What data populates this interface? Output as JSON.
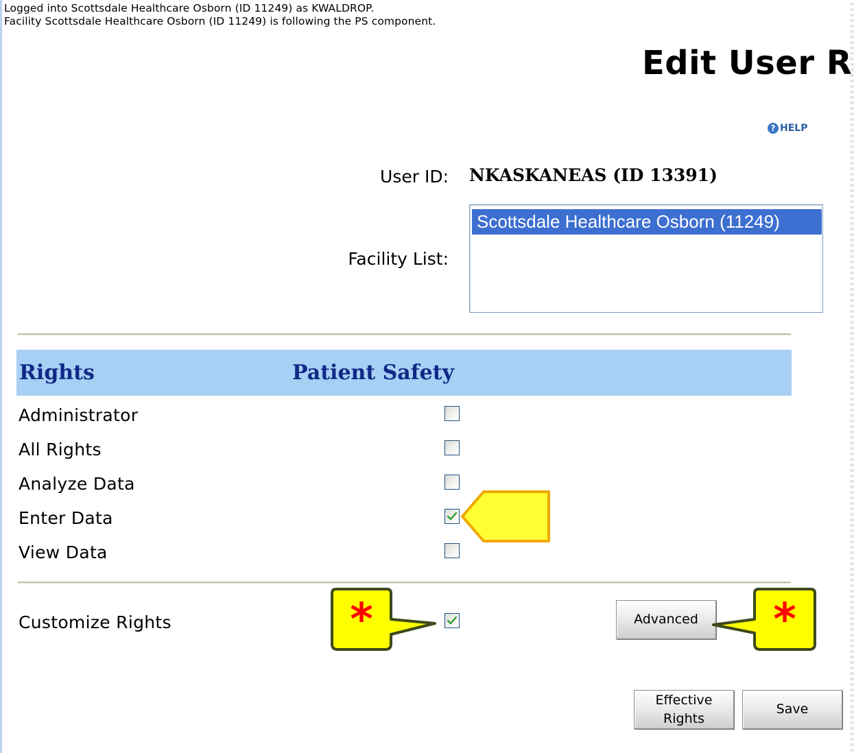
{
  "status": {
    "line1": "Logged into Scottsdale Healthcare Osborn (ID 11249) as KWALDROP.",
    "line2": "Facility Scottsdale Healthcare Osborn (ID 11249) is following the PS component."
  },
  "page_title": "Edit User R",
  "help": {
    "label": "HELP",
    "icon": "help-question-icon"
  },
  "user_id": {
    "label": "User ID:",
    "value": "NKASKANEAS (ID 13391)"
  },
  "facility_list": {
    "label": "Facility List:",
    "options": [
      "Scottsdale Healthcare Osborn (11249)"
    ],
    "selected": "Scottsdale Healthcare Osborn (11249)"
  },
  "rights_table": {
    "header_rights": "Rights",
    "header_component": "Patient Safety",
    "header_color": "#a8cff4",
    "rows": [
      {
        "label": "Administrator",
        "checked": false
      },
      {
        "label": "All Rights",
        "checked": false
      },
      {
        "label": "Analyze Data",
        "checked": false
      },
      {
        "label": "Enter Data",
        "checked": true
      },
      {
        "label": "View Data",
        "checked": false
      }
    ]
  },
  "customize_rights": {
    "label": "Customize Rights",
    "checked": true
  },
  "buttons": {
    "advanced": "Advanced",
    "effective_rights": "Effective Rights",
    "save": "Save"
  },
  "annotations": {
    "callout_symbol": "*",
    "callout_color": "#ffff00",
    "callout_border": "#3d4a1a",
    "star_color": "#ff0000",
    "arrow_color": "#ffff33",
    "arrow_border": "#f0a800"
  }
}
